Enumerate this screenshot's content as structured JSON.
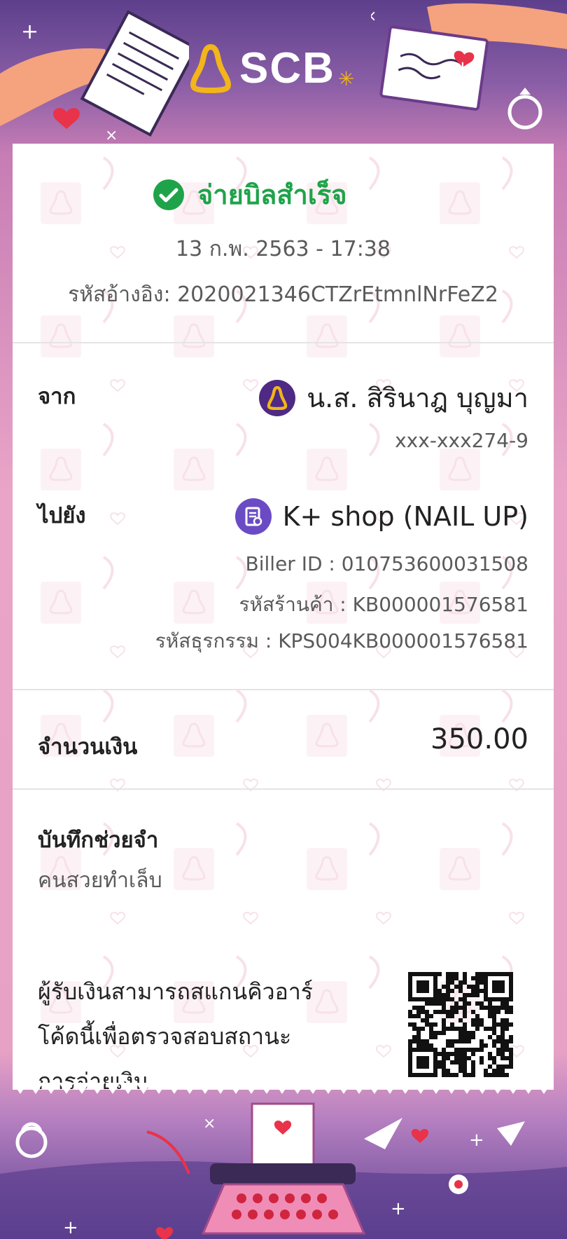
{
  "brand": {
    "name": "SCB",
    "accent": "#4e2a84",
    "gold": "#f2b51a"
  },
  "colors": {
    "success": "#1fa34a",
    "header": "#5d3f8c",
    "pink": "#e9a4c7"
  },
  "receipt": {
    "status": "จ่ายบิลสำเร็จ",
    "datetime": "13 ก.พ. 2563 - 17:38",
    "reference": "รหัสอ้างอิง: 2020021346CTZrEtmnlNrFeZ2",
    "from": {
      "label": "จาก",
      "name": "น.ส. สิรินาฎ บุญมา",
      "account": "xxx-xxx274-9",
      "icon": "scb-logo-icon"
    },
    "to": {
      "label": "ไปยัง",
      "name": "K+ shop (NAIL UP)",
      "biller_id": "Biller ID : 010753600031508",
      "shop_code": "รหัสร้านค้า : KB000001576581",
      "transaction_code": "รหัสธุรกรรม : KPS004KB000001576581",
      "icon": "bill-icon"
    },
    "amount": {
      "label": "จำนวนเงิน",
      "value": "350.00"
    },
    "memo": {
      "label": "บันทึกช่วยจำ",
      "value": "คนสวยทำเล็บ"
    },
    "qr_note": [
      "ผู้รับเงินสามารถสแกนคิวอาร์",
      "โค้ดนี้เพื่อตรวจสอบสถานะ",
      "การจ่ายเงิน"
    ]
  }
}
